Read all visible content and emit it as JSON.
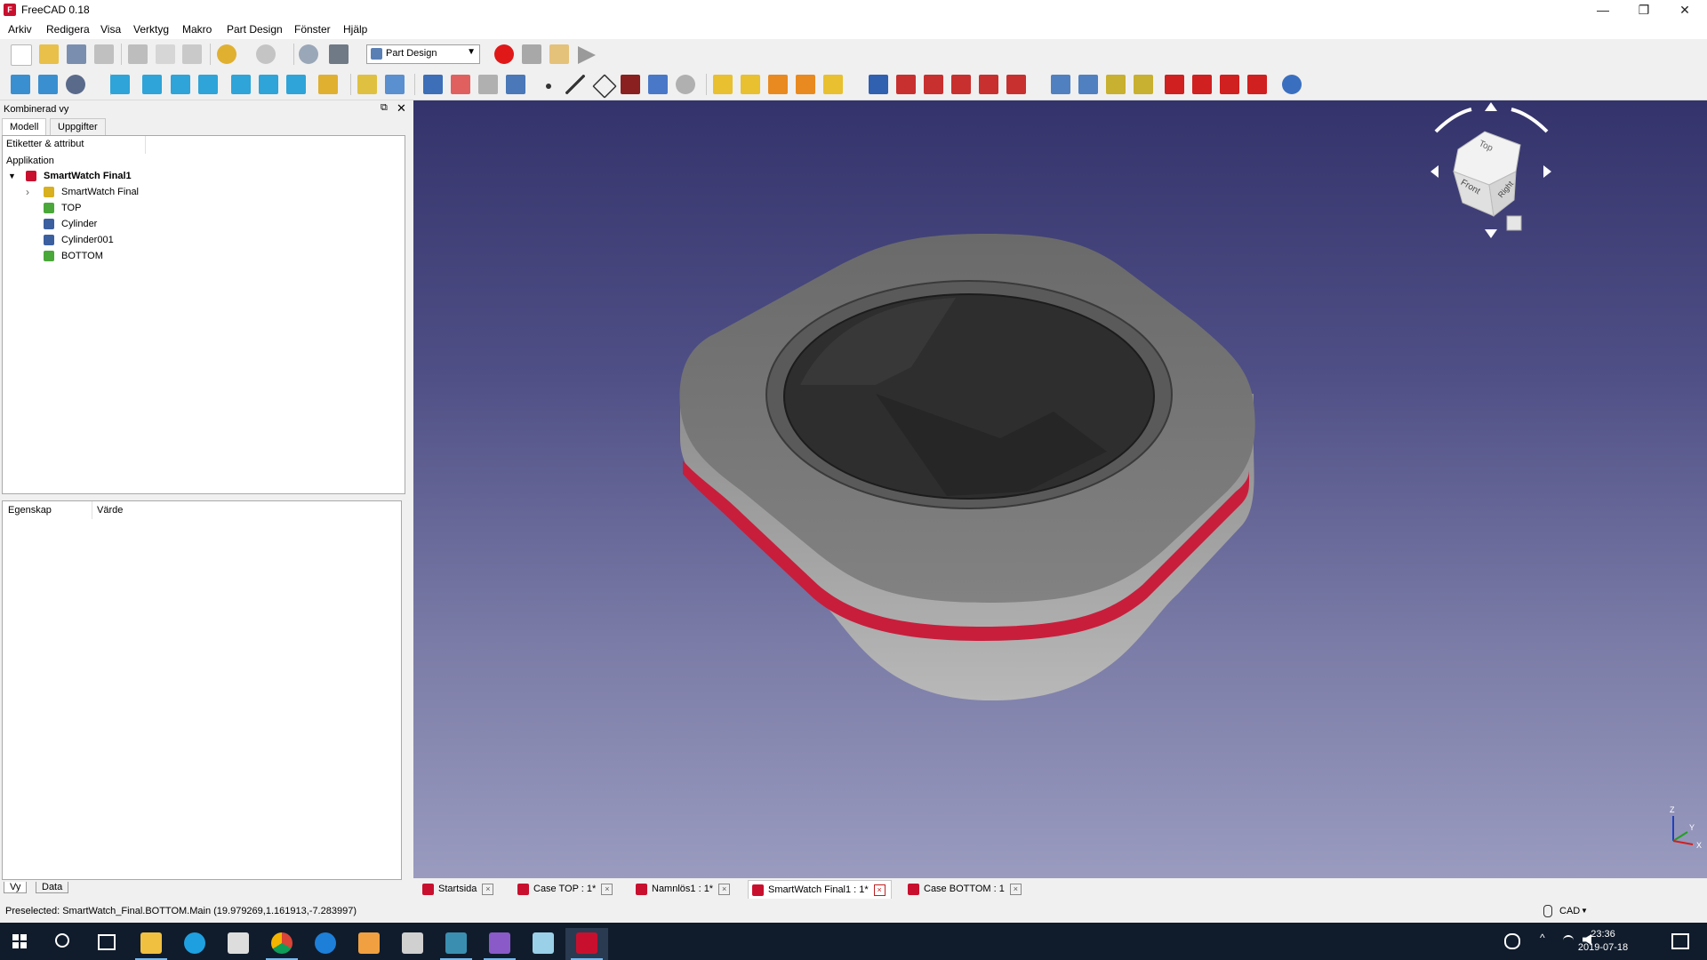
{
  "window": {
    "title": "FreeCAD 0.18",
    "app_icon_letter": "F",
    "controls": {
      "minimize": "—",
      "restore": "❐",
      "close": "✕"
    }
  },
  "menu": [
    "Arkiv",
    "Redigera",
    "Visa",
    "Verktyg",
    "Makro",
    "Part Design",
    "Fönster",
    "Hjälp"
  ],
  "toolbar": {
    "workbench": "Part Design",
    "macro_record_color": "#e01818"
  },
  "combo_view": {
    "title": "Kombinerad vy",
    "float_icon": "⧉",
    "close_icon": "✕",
    "tabs": [
      "Modell",
      "Uppgifter"
    ],
    "tree_header": "Etiketter & attribut",
    "tree": {
      "section": "Applikation",
      "document": "SmartWatch Final1",
      "items": [
        {
          "label": "SmartWatch Final",
          "icon": "body-icon",
          "color": "#d8b020",
          "expander": "›"
        },
        {
          "label": "TOP",
          "icon": "mesh-icon",
          "color": "#4aa83a"
        },
        {
          "label": "Cylinder",
          "icon": "part-icon",
          "color": "#3c5fa0"
        },
        {
          "label": "Cylinder001",
          "icon": "part-icon",
          "color": "#3c5fa0"
        },
        {
          "label": "BOTTOM",
          "icon": "mesh-icon",
          "color": "#4aa83a"
        }
      ]
    },
    "properties": {
      "col_property": "Egenskap",
      "col_value": "Värde"
    },
    "bottom_tabs": [
      "Vy",
      "Data"
    ]
  },
  "doc_tabs": [
    {
      "label": "Startsida",
      "active": false
    },
    {
      "label": "Case TOP : 1*",
      "active": false
    },
    {
      "label": "Namnlös1 : 1*",
      "active": false
    },
    {
      "label": "SmartWatch Final1 : 1*",
      "active": true
    },
    {
      "label": "Case BOTTOM : 1",
      "active": false
    }
  ],
  "navcube": {
    "top": "Top",
    "front": "Front",
    "right": "Right"
  },
  "axes": {
    "z": "Z",
    "y": "Y",
    "x": "X"
  },
  "status": {
    "preselected": "Preselected: SmartWatch_Final.BOTTOM.Main (19.979269,1.161913,-7.283997)",
    "navigation_style": "CAD"
  },
  "taskbar": {
    "time": "23:36",
    "date": "2019-07-18"
  },
  "colors": {
    "accent_band": "#c81e3c",
    "model_gray": "#8a8a8a",
    "view_top": "#34336b",
    "view_bottom": "#9a9bbf"
  }
}
